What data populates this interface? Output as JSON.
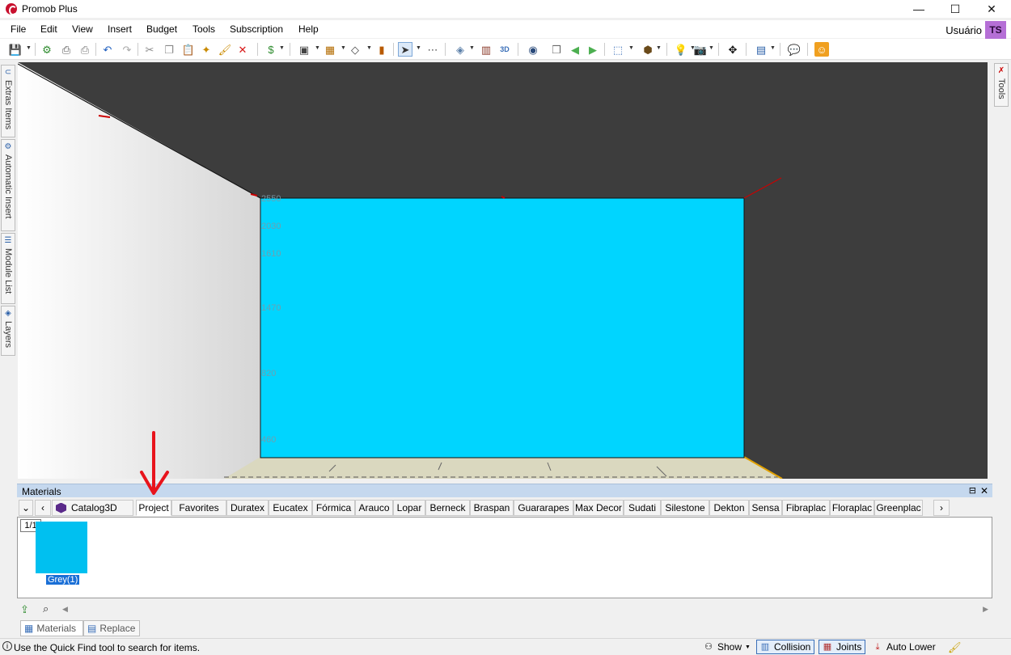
{
  "window": {
    "title": "Promob Plus",
    "minimize": "—",
    "maximize": "☐",
    "close": "✕"
  },
  "menu": {
    "items": [
      "File",
      "Edit",
      "View",
      "Insert",
      "Budget",
      "Tools",
      "Subscription",
      "Help"
    ],
    "user_label": "Usuário",
    "avatar_initials": "TS"
  },
  "left_dock": {
    "tabs": [
      "Extras Items",
      "Automatic Insert",
      "Module List",
      "Layers"
    ]
  },
  "right_dock": {
    "tabs": [
      "Tools"
    ]
  },
  "viewport": {
    "dimension_labels": [
      "2550",
      "2030",
      "1610",
      "1470",
      "820",
      "460"
    ],
    "colors": {
      "background": "#3d3d3d",
      "wall": "#00d5ff",
      "side_wall": "#e8e8e8",
      "floor": "#dad8bf",
      "edge_marker": "#cc0000"
    }
  },
  "materials": {
    "panel_title": "Materials",
    "pin_icon": "⊟",
    "close_icon": "✕",
    "catalog_label": "Catalog3D",
    "tabs": [
      "Project",
      "Favorites",
      "Duratex",
      "Eucatex",
      "Fórmica",
      "Arauco",
      "Lopar",
      "Berneck",
      "Braspan",
      "Guararapes",
      "Max Decor",
      "Sudati",
      "Silestone",
      "Dekton",
      "Sensa",
      "Fibraplac",
      "Floraplac",
      "Greenplac"
    ],
    "active_tab": "Project",
    "page_indicator": "1/1",
    "items": [
      {
        "label": "Grey(1)",
        "color": "#00c0f0"
      }
    ]
  },
  "bottom_tabs": [
    "Materials",
    "Replace"
  ],
  "status": {
    "message": "Use the Quick Find tool to search for items.",
    "show_label": "Show",
    "collision_label": "Collision",
    "joints_label": "Joints",
    "auto_lower_label": "Auto Lower"
  },
  "annotation": {
    "color": "#e8141c"
  }
}
